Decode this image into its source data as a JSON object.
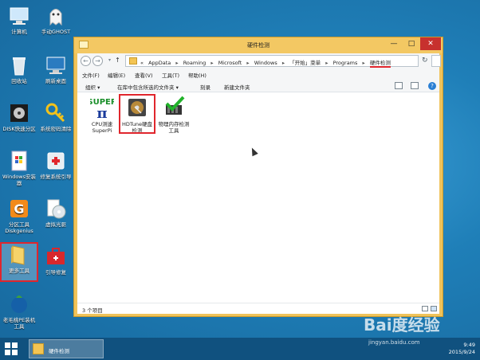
{
  "desktop": {
    "icons": [
      {
        "label": "计算机"
      },
      {
        "label": "手动GHOST"
      },
      {
        "label": "回收站"
      },
      {
        "label": "刷新桌面"
      },
      {
        "label": "DISK快速分区"
      },
      {
        "label": "系统密码清除"
      },
      {
        "label": "Windows安装器"
      },
      {
        "label": "修复系统引导"
      },
      {
        "label": "分区工具Diskgenius"
      },
      {
        "label": "虚拟光驱"
      },
      {
        "label": "更多工具"
      },
      {
        "label": "引导修复"
      },
      {
        "label": "老毛桃PE装机工具"
      }
    ]
  },
  "window": {
    "title": "硬件检测",
    "minimize": "—",
    "maximize": "□",
    "close": "✕",
    "nav": {
      "back": "←",
      "forward": "→",
      "up": "↑",
      "refresh": "↻"
    },
    "breadcrumb": [
      "«",
      "AppData",
      "▸",
      "Roaming",
      "▸",
      "Microsoft",
      "▸",
      "Windows",
      "▸",
      "「开始」菜单",
      "▸",
      "Programs",
      "▸",
      "硬件检测"
    ],
    "menu": [
      "文件(F)",
      "编辑(E)",
      "查看(V)",
      "工具(T)",
      "帮助(H)"
    ],
    "toolbar": {
      "organize": "组织 ▾",
      "include": "在库中包含所选的文件夹 ▾",
      "burn": "刻录",
      "new_folder": "新建文件夹",
      "help": "?"
    },
    "files": [
      {
        "label": "CPU测速SuperPi",
        "logo_top": "SUPER",
        "logo_bottom": "π"
      },
      {
        "label": "HDTune硬盘检测"
      },
      {
        "label": "物理内存检测工具"
      }
    ],
    "status": "3 个项目"
  },
  "taskbar": {
    "task_label": "硬件检测",
    "time": "9:49",
    "date": "2015/9/24"
  },
  "watermark": {
    "main": "Bai度经验",
    "sub": "jingyan.baidu.com"
  }
}
